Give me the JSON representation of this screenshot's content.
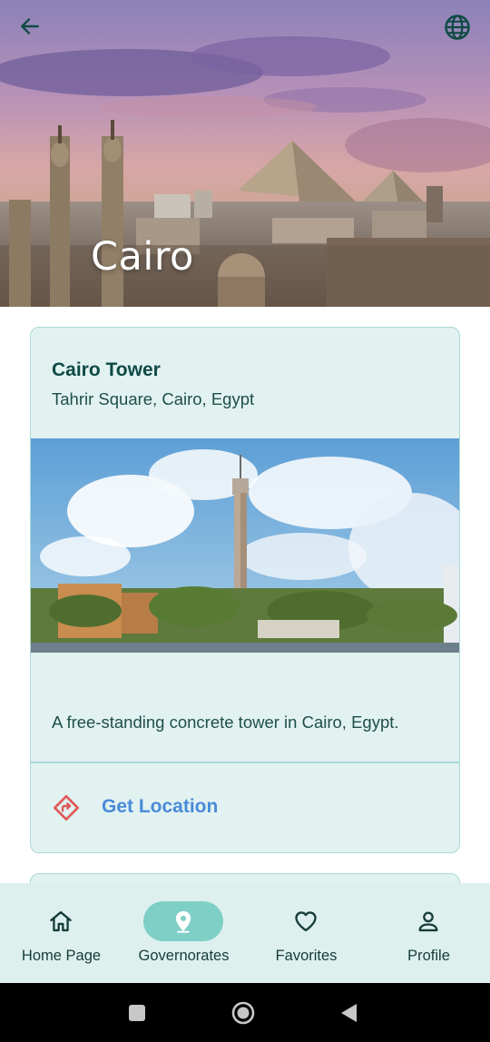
{
  "header": {
    "title": "Cairo",
    "back_icon": "arrow-left-icon",
    "language_icon": "globe-icon"
  },
  "place_card": {
    "title": "Cairo Tower",
    "subtitle": "Tahrir Square, Cairo, Egypt",
    "description": "A free-standing concrete tower in Cairo, Egypt.",
    "action_label": "Get Location",
    "action_icon": "directions-icon"
  },
  "bottom_nav": {
    "items": [
      {
        "label": "Home Page",
        "icon": "home-icon"
      },
      {
        "label": "Governorates",
        "icon": "location-pin-icon"
      },
      {
        "label": "Favorites",
        "icon": "heart-icon"
      },
      {
        "label": "Profile",
        "icon": "person-icon"
      }
    ],
    "active_index": 1
  },
  "colors": {
    "accent": "#7ecfc6",
    "card_bg": "#e1f2f1",
    "link": "#4a8ad8",
    "title_dark": "#0f4a45",
    "danger_icon": "#e05a5a"
  }
}
